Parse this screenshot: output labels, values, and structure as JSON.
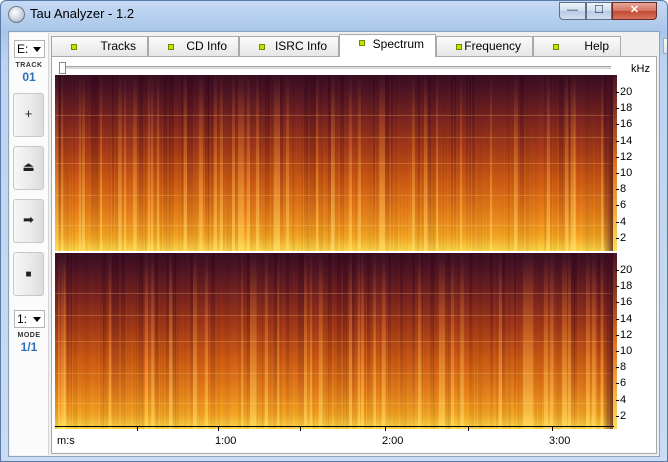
{
  "window": {
    "title": "Tau Analyzer - 1.2",
    "min_icon": "minimize-icon",
    "max_icon": "maximize-icon",
    "close_icon": "close-icon",
    "min_glyph": "—",
    "max_glyph": "☐",
    "close_glyph": "✕"
  },
  "left": {
    "drive_value": "E:",
    "track_label": "TRACK",
    "track_value": "01",
    "buttons": [
      {
        "icon": "add-icon",
        "glyph": "+"
      },
      {
        "icon": "eject-icon",
        "glyph": "⏏"
      },
      {
        "icon": "forward-icon",
        "glyph": "➡"
      },
      {
        "icon": "stop-icon",
        "glyph": "■"
      }
    ],
    "mode_value": "1:",
    "mode_label": "MODE",
    "mode_ratio": "1/1"
  },
  "tabs": [
    {
      "label": "Tracks",
      "active": false
    },
    {
      "label": "CD Info",
      "active": false
    },
    {
      "label": "ISRC Info",
      "active": false
    },
    {
      "label": "Spectrum",
      "active": true
    },
    {
      "label": "Frequency",
      "active": false
    },
    {
      "label": "Help",
      "active": false
    }
  ],
  "tab_scroll": {
    "left_glyph": "◂",
    "right_glyph": "▸"
  },
  "spectrum": {
    "unit_label": "kHz",
    "y_ticks": [
      "20",
      "18",
      "16",
      "14",
      "12",
      "10",
      "8",
      "6",
      "4",
      "2"
    ],
    "x_axis_label": "m:s",
    "x_ticks": [
      "1:00",
      "2:00",
      "3:00"
    ],
    "colors": {
      "low": "#fdd84a",
      "mid": "#cf5b14",
      "high": "#3a0f22"
    }
  }
}
